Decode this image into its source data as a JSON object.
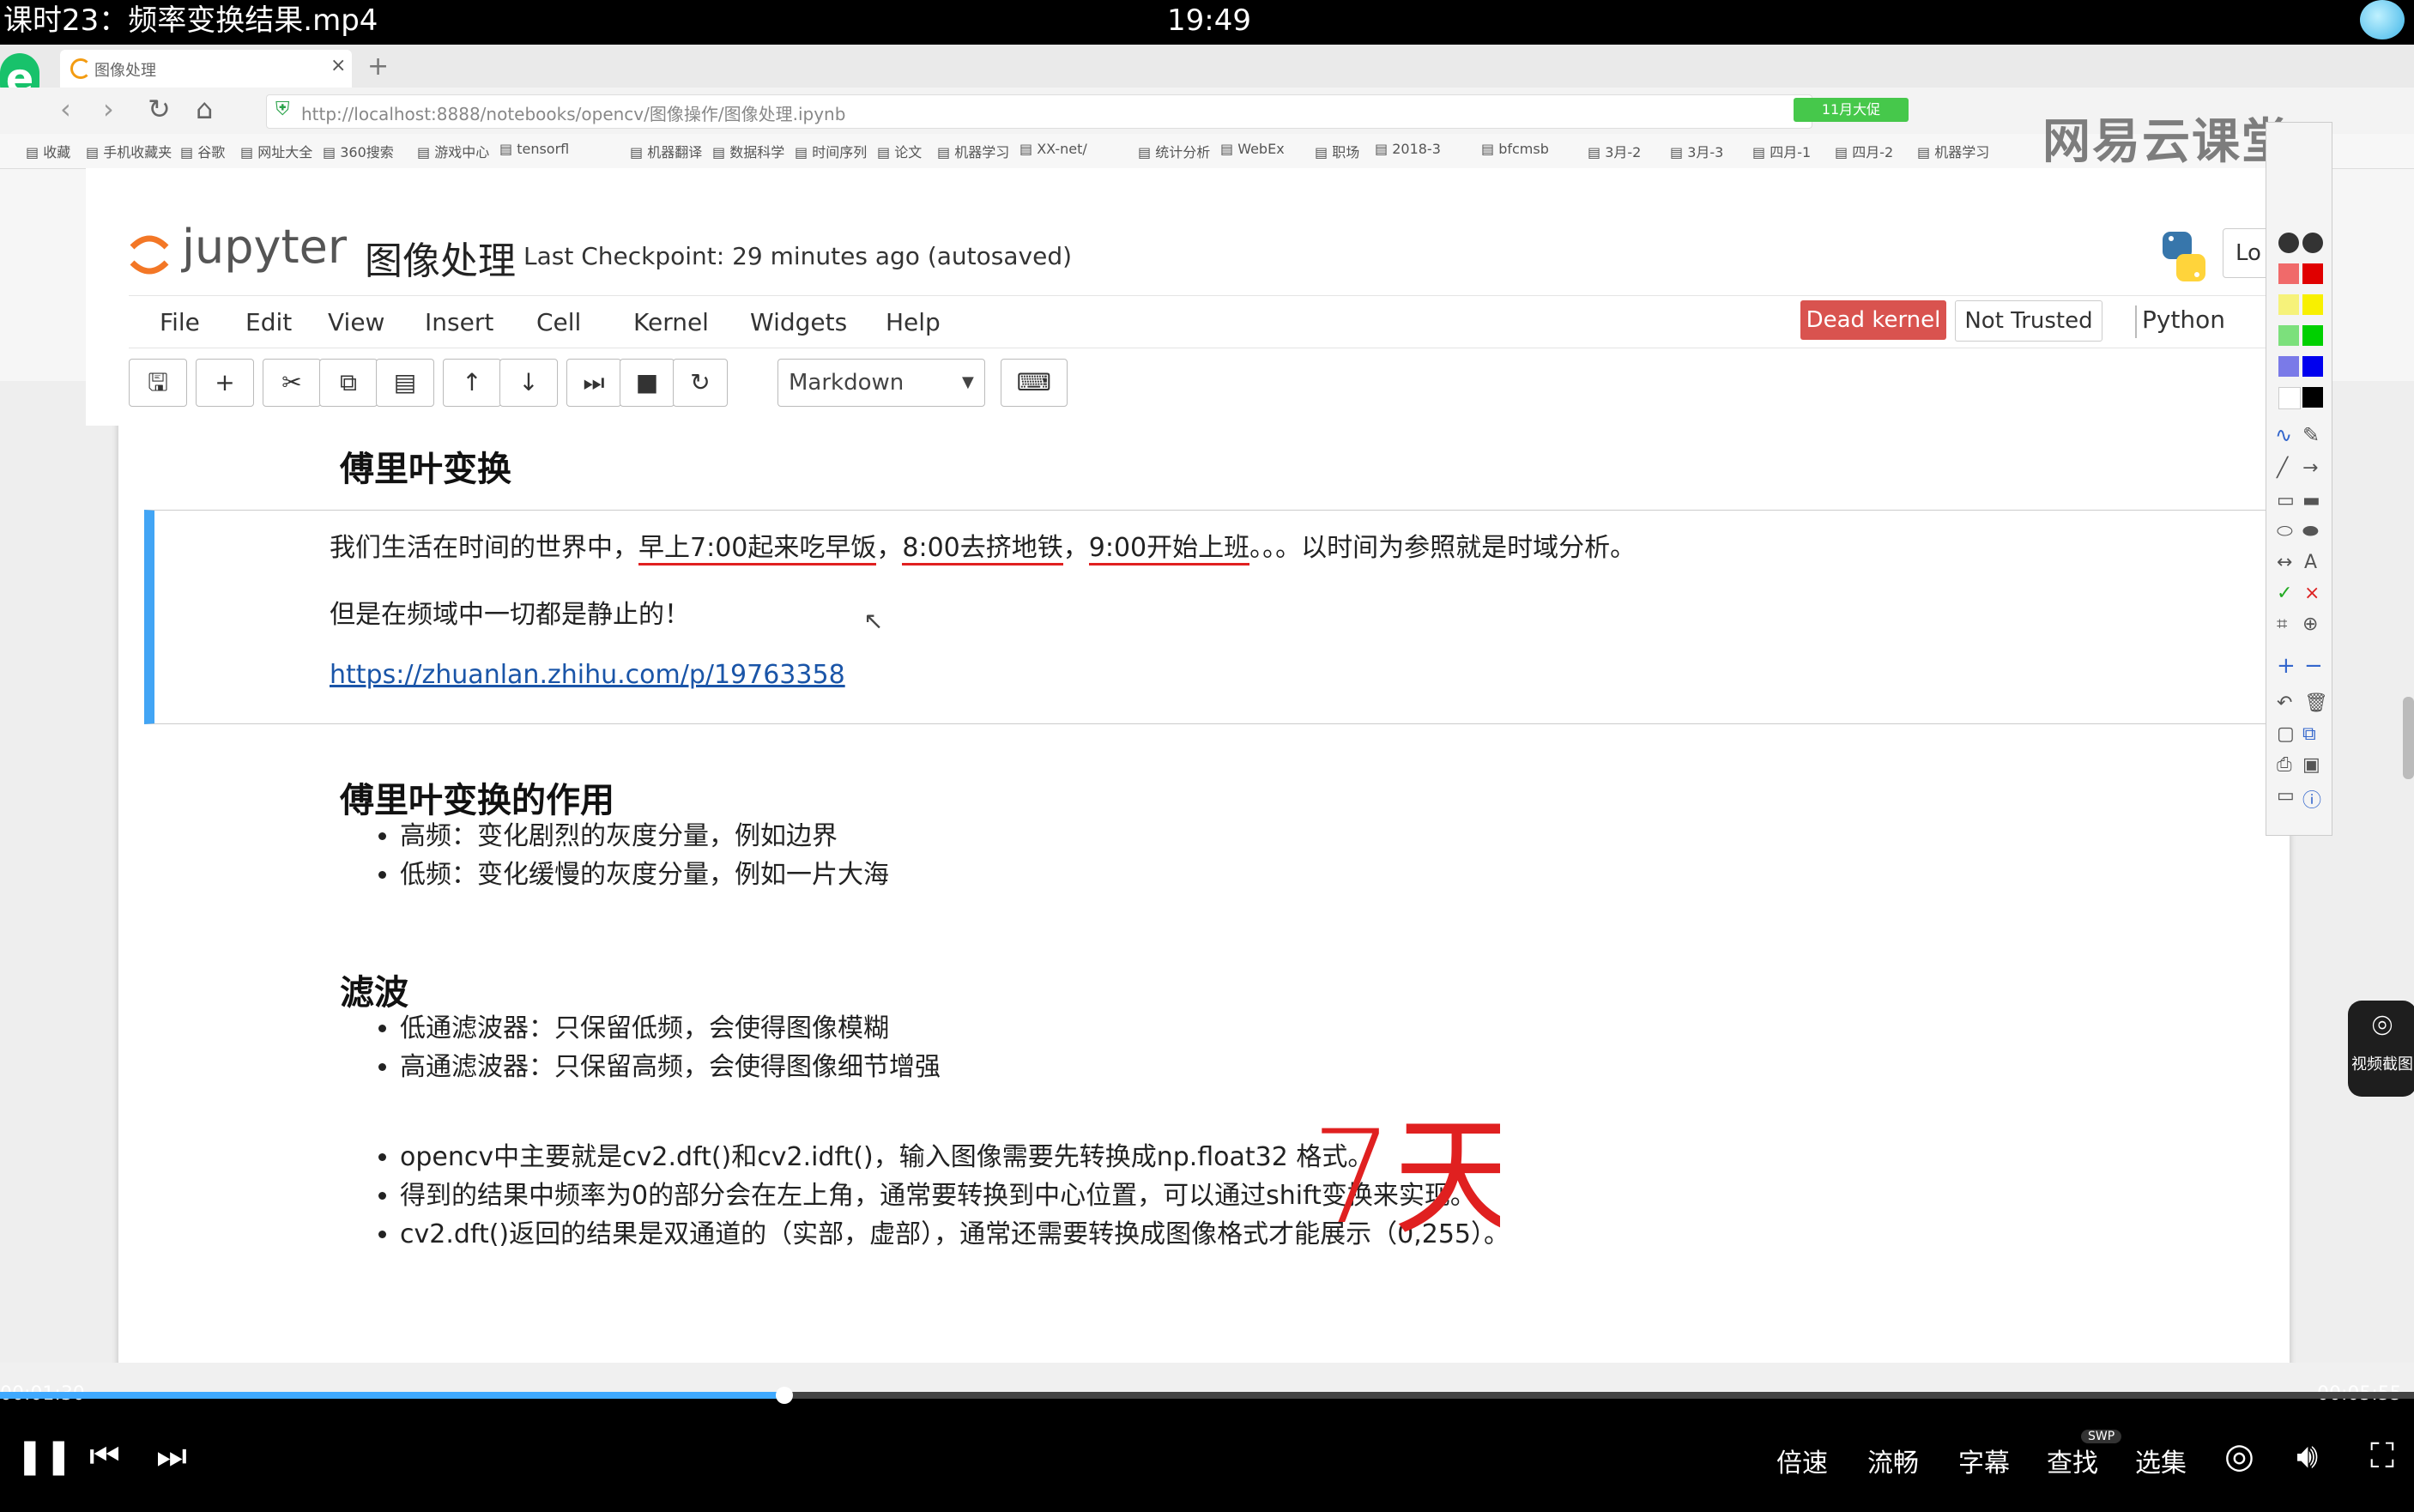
{
  "player": {
    "title": "课时23：频率变换结果.mp4",
    "clock": "19:49",
    "time_current": "00:01:30",
    "time_total": "00:05:55",
    "progress": 0.325,
    "controls": {
      "speed": "倍速",
      "quality": "流畅",
      "subtitle": "字幕",
      "search": "查找",
      "episodes": "选集",
      "swp_badge": "SWP"
    },
    "screenshot_label": "视频截图"
  },
  "browser": {
    "tab_title": "图像处理",
    "url": "http://localhost:8888/notebooks/opencv/图像操作/图像处理.ipynb",
    "green_chip": "11月大促",
    "watermark": "网易云课堂",
    "bookmarks": [
      "收藏",
      "手机收藏夹",
      "谷歌",
      "网址大全",
      "360搜索",
      "游戏中心",
      "tensorfl",
      "机器翻译",
      "数据科学",
      "时间序列",
      "论文",
      "机器学习",
      "XX-net/",
      "统计分析",
      "WebEx",
      "职场",
      "2018-3",
      "bfcmsb",
      "3月-2",
      "3月-3",
      "四月-1",
      "四月-2",
      "机器学习"
    ]
  },
  "jupyter": {
    "wordmark": "jupyter",
    "notebook_title": "图像处理",
    "checkpoint": "Last Checkpoint: 29 minutes ago (autosaved)",
    "login": "Lo",
    "menu": [
      "File",
      "Edit",
      "View",
      "Insert",
      "Cell",
      "Kernel",
      "Widgets",
      "Help"
    ],
    "dead_kernel": "Dead kernel",
    "not_trusted": "Not Trusted",
    "kernel_name": "Python",
    "cell_type": "Markdown"
  },
  "notebook": {
    "h_fourier": "傅里叶变换",
    "intro_plain1": "我们生活在时间的世界中，",
    "intro_u1": "早上7:00起来吃早饭",
    "intro_sep1": "，",
    "intro_u2": "8:00去挤地铁",
    "intro_sep2": "，",
    "intro_u3": "9:00开始上班",
    "intro_tail": "。。。以时间为参照就是时域分析。",
    "static_line": "但是在频域中一切都是静止的！",
    "link": "https://zhuanlan.zhihu.com/p/19763358",
    "h_role": "傅里叶变换的作用",
    "role_items": [
      "高频：变化剧烈的灰度分量，例如边界",
      "低频：变化缓慢的灰度分量，例如一片大海"
    ],
    "h_filter": "滤波",
    "filter_items": [
      "低通滤波器：只保留低频，会使得图像模糊",
      "高通滤波器：只保留高频，会使得图像细节增强"
    ],
    "opencv_items": [
      "opencv中主要就是cv2.dft()和cv2.idft()，输入图像需要先转换成np.float32 格式。",
      "得到的结果中频率为0的部分会在左上角，通常要转换到中心位置，可以通过shift变换来实现。",
      "cv2.dft()返回的结果是双通道的（实部，虚部），通常还需要转换成图像格式才能展示（0,255）。"
    ],
    "handwritten": "7天"
  },
  "colors": {
    "accent_blue": "#42a5f5",
    "dead_kernel": "#d9534f",
    "ink_red": "#e02020",
    "progress": "#3fa9ff"
  }
}
